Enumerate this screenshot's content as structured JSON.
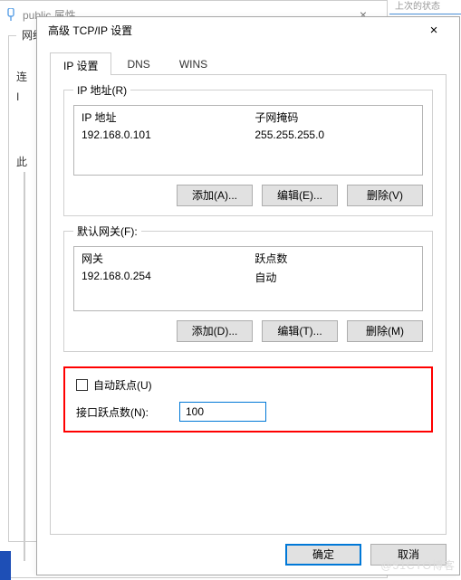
{
  "bg": {
    "title": "public 属性",
    "tab": "网络",
    "row1": "连",
    "row2": "I",
    "row3": "此",
    "top_hint": "上次的状态"
  },
  "dlg": {
    "title": "高级 TCP/IP 设置",
    "tabs": {
      "ip": "IP 设置",
      "dns": "DNS",
      "wins": "WINS"
    },
    "ip_group": {
      "legend": "IP 地址(R)",
      "col_ip": "IP 地址",
      "col_mask": "子网掩码",
      "row_ip": "192.168.0.101",
      "row_mask": "255.255.255.0",
      "add": "添加(A)...",
      "edit": "编辑(E)...",
      "del": "删除(V)"
    },
    "gw_group": {
      "legend": "默认网关(F):",
      "col_gw": "网关",
      "col_metric": "跃点数",
      "row_gw": "192.168.0.254",
      "row_metric": "自动",
      "add": "添加(D)...",
      "edit": "编辑(T)...",
      "del": "删除(M)"
    },
    "metric": {
      "auto": "自动跃点(U)",
      "label": "接口跃点数(N):",
      "value": "100"
    },
    "ok": "确定",
    "cancel": "取消"
  },
  "watermark": "@51CTO博客"
}
